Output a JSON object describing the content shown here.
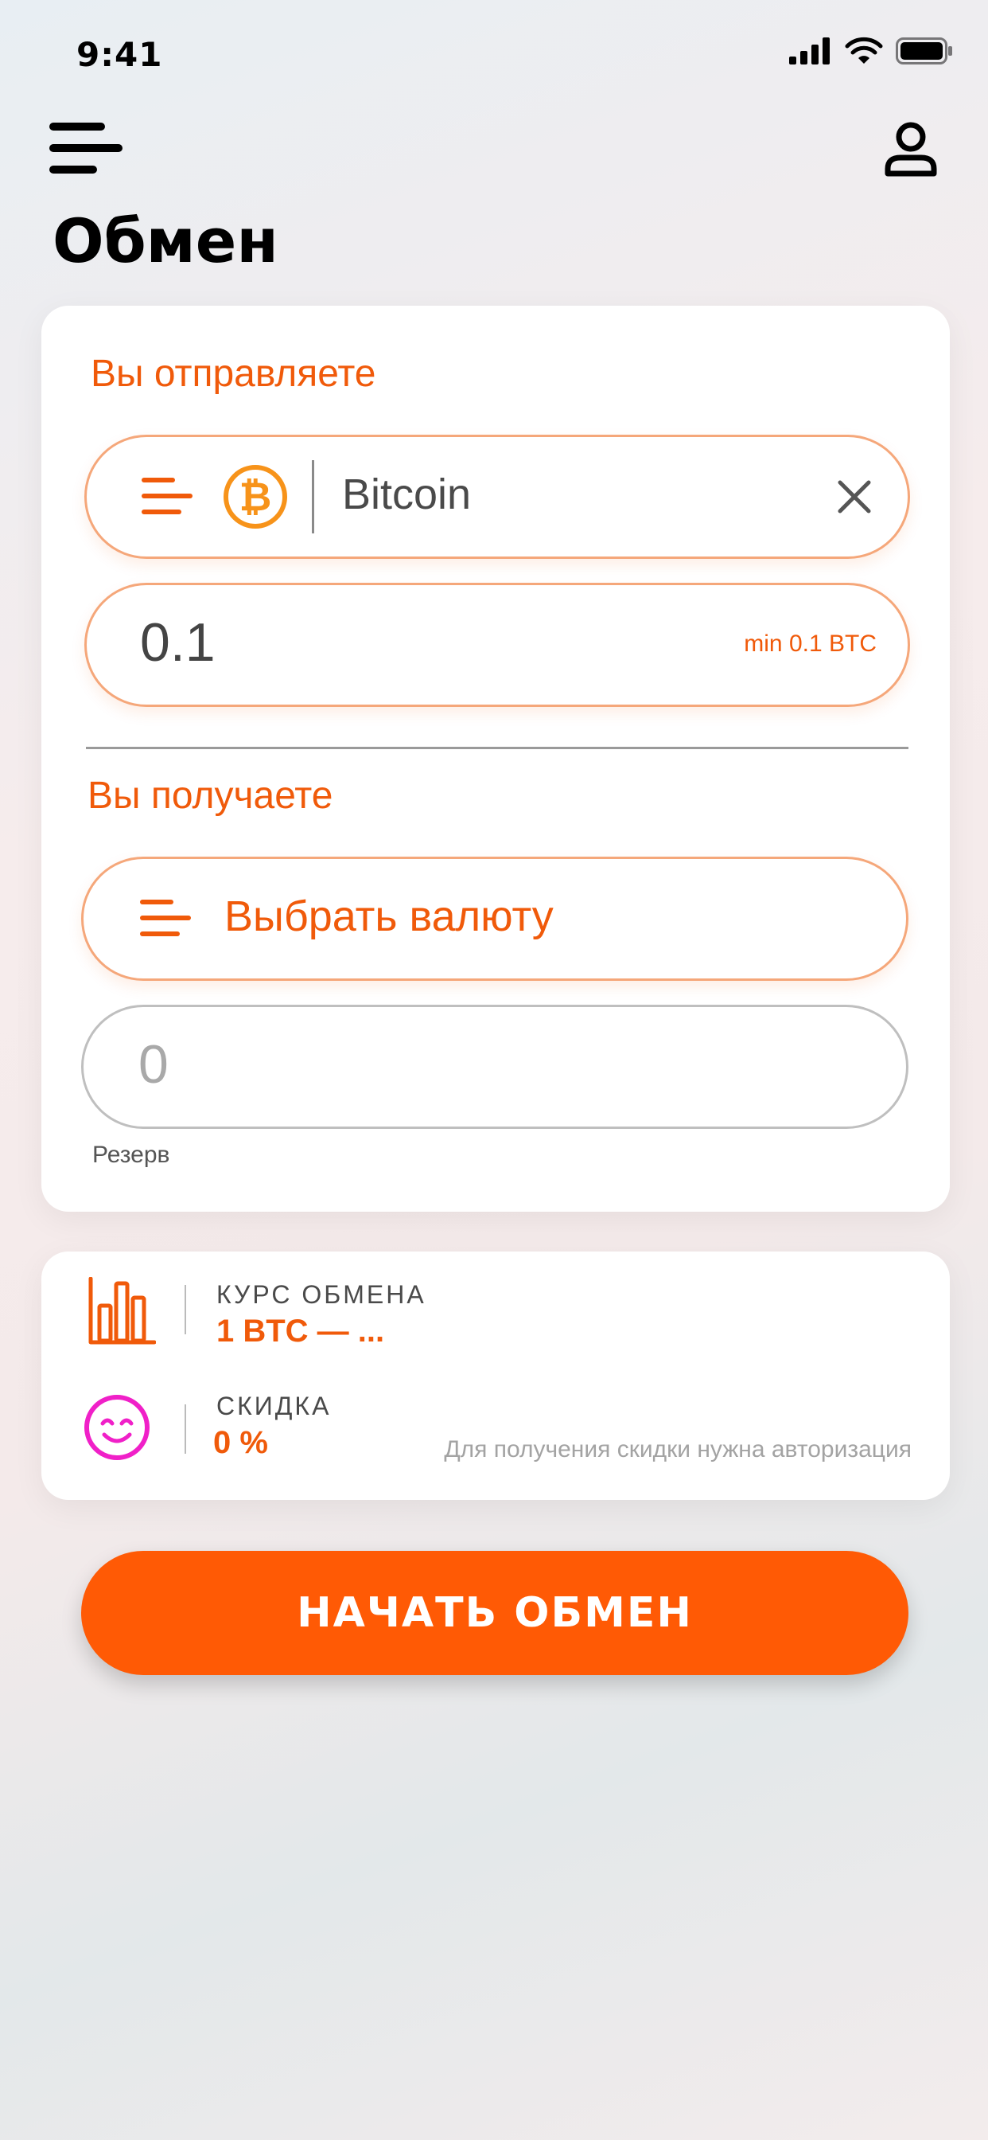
{
  "status_bar": {
    "time": "9:41",
    "icons": [
      "signal-icon",
      "wifi-icon",
      "battery-icon"
    ]
  },
  "header": {
    "menu_icon": "menu-icon",
    "profile_icon": "user-icon",
    "title": "Обмен"
  },
  "send": {
    "label": "Вы отправляете",
    "currency_name": "Bitcoin",
    "currency_icon": "bitcoin-icon",
    "clear_icon": "close-icon",
    "amount": "0.1",
    "min_hint": "min 0.1 BTC"
  },
  "receive": {
    "label": "Вы получаете",
    "select_placeholder": "Выбрать валюту",
    "amount": "0",
    "reserve_label": "Резерв"
  },
  "info": {
    "rate_label": "КУРС ОБМЕНА",
    "rate_value": "1 BTC — ...",
    "rate_icon": "bar-chart-icon",
    "discount_label": "СКИДКА",
    "discount_value": "0 %",
    "discount_icon": "smiley-icon",
    "discount_note": "Для получения скидки нужна авторизация"
  },
  "cta": {
    "label": "НАЧАТЬ ОБМЕН"
  },
  "colors": {
    "accent": "#ff5a05",
    "accent_text": "#f05a0a",
    "bitcoin": "#f7931a",
    "smiley": "#f020c8"
  }
}
